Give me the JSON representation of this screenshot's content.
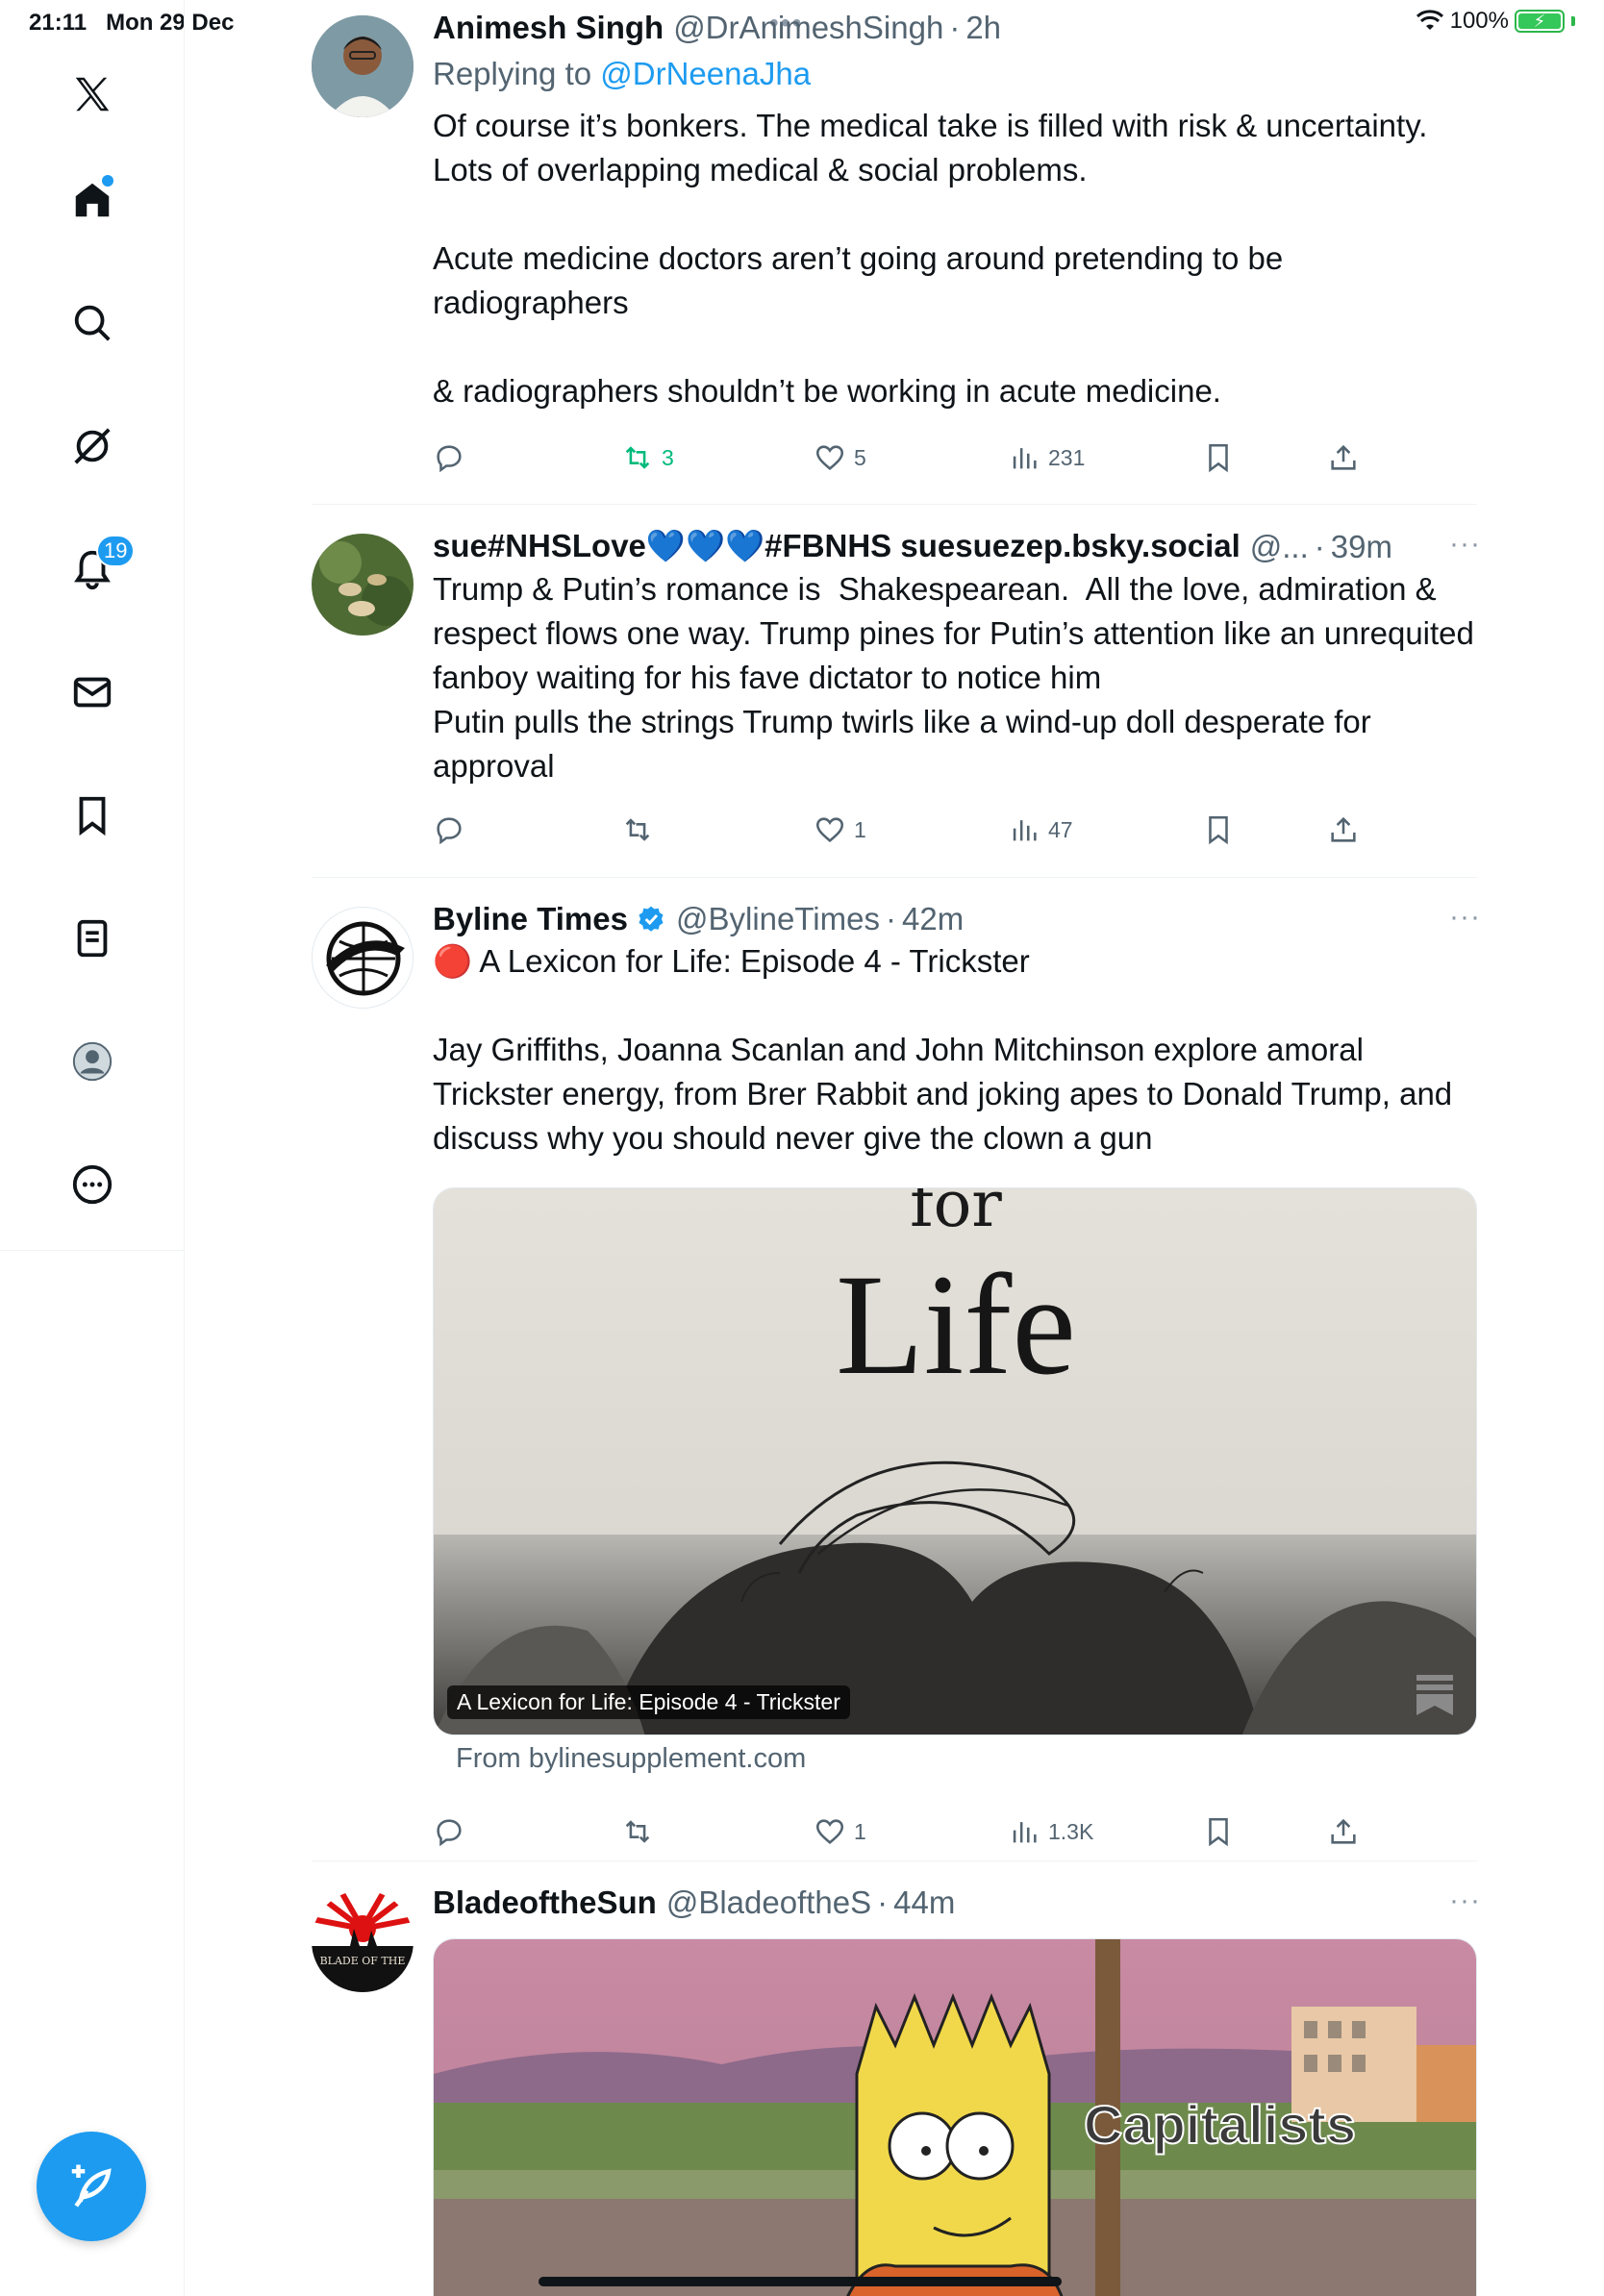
{
  "status": {
    "time": "21:11",
    "date": "Mon 29 Dec",
    "battery": "100%",
    "dots": "•••"
  },
  "sidebar": {
    "notifications_badge": "19"
  },
  "tweets": [
    {
      "name": "Animesh Singh",
      "handle": "@DrAnimeshSingh",
      "sep": "·",
      "time": "2h",
      "reply_prefix": "Replying to",
      "reply_to": "@DrNeenaJha",
      "text": "Of course it’s bonkers. The medical take is filled with risk & uncertainty. Lots of overlapping medical & social problems.\n\nAcute medicine doctors aren’t going around pretending to be radiographers\n\n& radiographers shouldn’t be working in acute medicine.",
      "retweets": "3",
      "likes": "5",
      "views": "231"
    },
    {
      "name": "sue#NHSLove💙💙💙#FBNHS suesuezep.bsky.social",
      "handle": "@...",
      "sep": "·",
      "time": "39m",
      "more": "···",
      "text": "Trump & Putin’s romance is  Shakespearean.  All the love, admiration & respect flows one way. Trump pines for Putin’s attention like an unrequited fanboy waiting for his fave dictator to notice him\nPutin pulls the strings Trump twirls like a wind-up doll desperate for approval",
      "retweets": "",
      "likes": "1",
      "views": "47"
    },
    {
      "name": "Byline Times",
      "handle": "@BylineTimes",
      "sep": "·",
      "time": "42m",
      "more": "···",
      "text": "🔴 A Lexicon for Life: Episode 4 - Trickster\n\nJay Griffiths, Joanna Scanlan and John Mitchinson explore amoral Trickster energy, from Brer Rabbit and joking apes to Donald Trump, and discuss why you should never give the clown a gun",
      "media_caption": "A Lexicon for Life: Episode 4 - Trickster",
      "media_text_top": "for",
      "media_text_big": "Life",
      "from": "From bylinesupplement.com",
      "retweets": "",
      "likes": "1",
      "views": "1.3K"
    },
    {
      "name": "BladeoftheSun",
      "handle": "@BladeoftheS",
      "sep": "·",
      "time": "44m",
      "more": "···",
      "media_label": "Capitalists",
      "avatar_text": "BLADE OF THE"
    }
  ]
}
